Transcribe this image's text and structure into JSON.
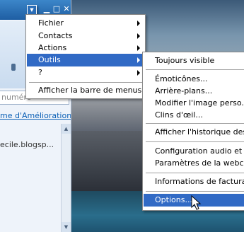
{
  "main_menu": {
    "items": [
      {
        "label": "Fichier",
        "submenu": true
      },
      {
        "label": "Contacts",
        "submenu": true
      },
      {
        "label": "Actions",
        "submenu": true
      },
      {
        "label": "Outils",
        "submenu": true,
        "highlighted": true
      },
      {
        "label": "?",
        "submenu": true
      },
      {
        "label": "Afficher la barre de menus",
        "submenu": false
      }
    ]
  },
  "tools_submenu": {
    "items": [
      {
        "label": "Toujours visible"
      },
      {
        "label": "Émoticônes..."
      },
      {
        "label": "Arrière-plans..."
      },
      {
        "label": "Modifier l'image perso..."
      },
      {
        "label": "Clins d'œil..."
      },
      {
        "label": "Afficher l'historique des ale"
      },
      {
        "label": "Configuration audio et vide"
      },
      {
        "label": "Paramètres de la webcam..."
      },
      {
        "label": "Informations de facturatio"
      },
      {
        "label": "Options...",
        "highlighted": true
      }
    ]
  },
  "window": {
    "search_placeholder": "numéro",
    "link_text": "me d'Amélioration",
    "url_text": "ecile.blogsp..."
  },
  "colors": {
    "highlight": "#316ac5",
    "titlebar": "#1e5ea3"
  }
}
